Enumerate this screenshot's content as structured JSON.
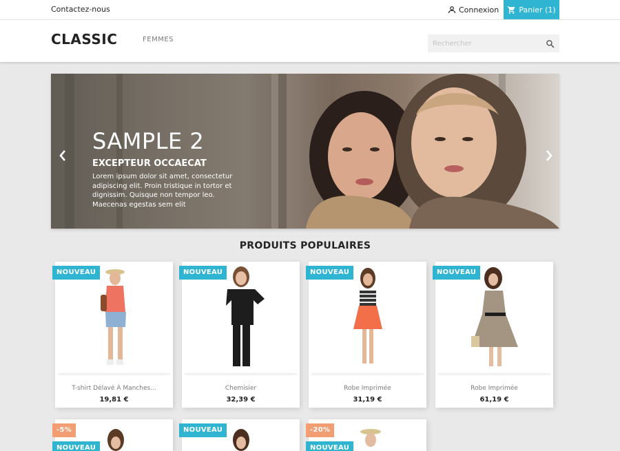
{
  "topnav": {
    "contact": "Contactez-nous",
    "login": "Connexion",
    "cart": "Panier (1)"
  },
  "header": {
    "logo": "CLASSIC",
    "menu_femmes": "FEMMES",
    "search_placeholder": "Rechercher"
  },
  "slider": {
    "title": "SAMPLE 2",
    "subtitle": "EXCEPTEUR OCCAECAT",
    "text": "Lorem ipsum dolor sit amet, consectetur adipiscing elit. Proin tristique in tortor et dignissim. Quisque non tempor leo. Maecenas egestas sem elit"
  },
  "section_title": "PRODUITS POPULAIRES",
  "products": [
    {
      "flag": "NOUVEAU",
      "name": "T-shirt Délavé À Manches...",
      "price": "19,81 €"
    },
    {
      "flag": "NOUVEAU",
      "name": "Chemisier",
      "price": "32,39 €"
    },
    {
      "flag": "NOUVEAU",
      "name": "Robe Imprimée",
      "price": "31,19 €"
    },
    {
      "flag": "NOUVEAU",
      "name": "Robe Imprimée",
      "price": "61,19 €"
    }
  ],
  "products_row2": [
    {
      "discount": "-5%",
      "flag": "NOUVEAU"
    },
    {
      "flag": "NOUVEAU"
    },
    {
      "discount": "-20%",
      "flag": "NOUVEAU"
    }
  ],
  "colors": {
    "accent": "#2fb5d2",
    "discount": "#f39d72",
    "background": "#e9e9e9"
  }
}
